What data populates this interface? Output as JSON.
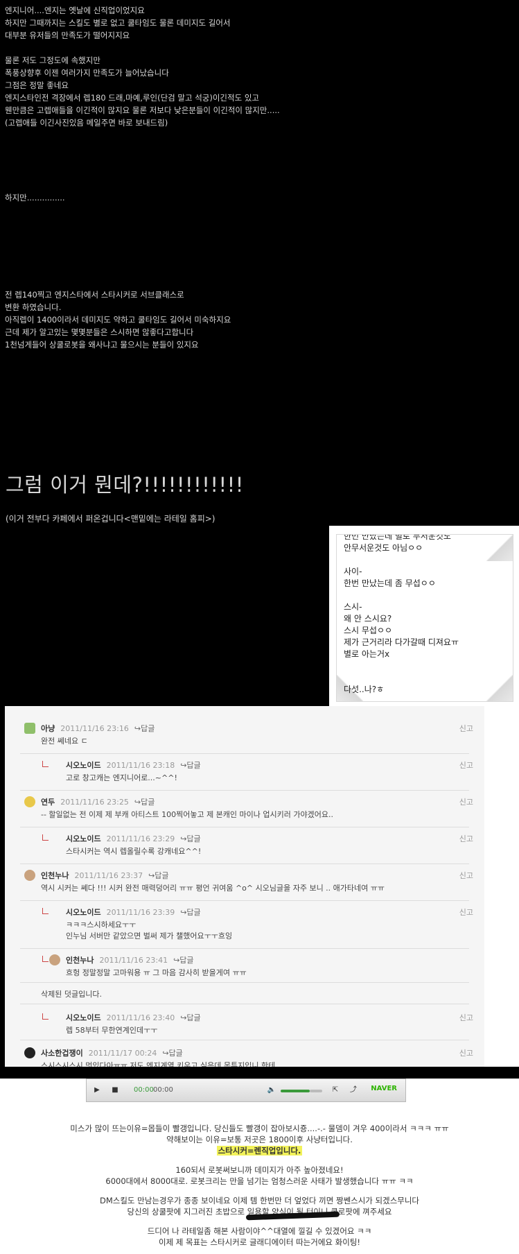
{
  "post": {
    "intro_lines": [
      "엔지니어....엔지는 옛날에 신직업이었지요",
      "하지만 그때까지는 스킬도 별로 없고 쿨타임도 물론 데미지도 길어서",
      "대부분 유저들의 만족도가 떨어지지요",
      "",
      "물론 저도 그정도에 속했지만",
      "폭풍상향후 이젠 여러가지 만족도가 늘어났습니다",
      "그점은 정말 좋네요",
      "엔지스타인전 격장에서 렙180 드래,마예,루인(단검 말고 석궁)이긴적도 있고",
      "웬만큼은 고렙애들을 이긴적이 많지요 물론 저보다 낮은분들이 이긴적이 많지만.....",
      "(고렙애들 이긴사진있음 메일주면 바로 보내드림)"
    ],
    "but_line": "하지만...............",
    "middle_lines": [
      "전 렙140찍고 엔지스타에서 스타시커로 서브클래스로",
      "변환 하였습니다.",
      "아직렙이 1400이라서 데미지도 약하고 쿨타임도 길어서 미숙하지요",
      "근데 제가 알고있는 몇몇분들은 스시하면 않좋다고합니다",
      "1천넘게들어 상쿨로봇을 왜사냐고 물으시는 분들이 있지요"
    ],
    "headline": "그럼 이거 뭔데?!!!!!!!!!!!!",
    "cafe_note": "(이거 전부다 카페에서 퍼온겁니다<맨밑에는 라테일 홈피>)"
  },
  "note": {
    "lines": [
      "한번 만났는데 별로 무서운것도",
      "안무서운것도 아님ㅇㅇ",
      "",
      "사이-",
      "한번 만났는데 좀 무섭ㅇㅇ",
      "",
      "스시-",
      "왜 안 스시요?",
      "스시 무섭ㅇㅇ",
      "제가 근거리라 다가갈때 디져요ㅠ",
      "별로 아는거x",
      "",
      "",
      "다섯..나?ㅎ"
    ]
  },
  "comments": [
    {
      "nick": "아냥",
      "date": "2011/11/16 23:16",
      "reply": "↪답글",
      "body": "완전 쎄네요 ㄷ",
      "report": "신고",
      "indent": false
    },
    {
      "nick": "시오노이드",
      "date": "2011/11/16 23:18",
      "reply": "↪답글",
      "body": "고로 창고캐는 엔지니어로...~^^!",
      "report": "신고",
      "indent": true
    },
    {
      "nick": "연두",
      "date": "2011/11/16 23:25",
      "reply": "↪답글",
      "body": "-- 할일없는 전 이제 제 부캐 아티스트 100찍어놓고 제 본캐인 마이나 업시키러 가야겠어요..",
      "report": "신고",
      "indent": false
    },
    {
      "nick": "시오노이드",
      "date": "2011/11/16 23:29",
      "reply": "↪답글",
      "body": "스타시커는 역시 렙올릴수록 강캐네요^^!",
      "report": "신고",
      "indent": true
    },
    {
      "nick": "인천누나",
      "date": "2011/11/16 23:37",
      "reply": "↪답글",
      "body": "역시 시커는 쎄다 !!! 시커 완전 매력덩어리 ㅠㅠ 평언 귀여움 ^o^ 시오님글을 자주 보니 .. 애가타네여 ㅠㅠ",
      "report": "신고",
      "indent": false
    },
    {
      "nick": "시오노이드",
      "date": "2011/11/16 23:39",
      "reply": "↪답글",
      "body": "ㅋㅋㅋ스시하세요ㅜㅜ",
      "body2": "인누님 서버만 같았으면 벌써 제가 챌했어요ㅜㅜ흐잉",
      "report": "신고",
      "indent": true
    },
    {
      "nick": "인천누나",
      "date": "2011/11/16 23:41",
      "reply": "↪답글",
      "body": "흐헝 정말정말 고마워용 ㅠ 그 마음 감사히 받을게여 ㅠㅠ",
      "report": "신고",
      "indent": true
    },
    {
      "deleted": "삭제된 덧글입니다."
    },
    {
      "nick": "시오노이드",
      "date": "2011/11/16 23:40",
      "reply": "↪답글",
      "body": "렙 58부터 무한연계인데ㅜㅜ",
      "report": "신고",
      "indent": true
    },
    {
      "nick": "사소한겁쟁이",
      "date": "2011/11/17 00:24",
      "reply": "↪답글",
      "body": "스시스시스시 멋있다아ㅠㅠ 저도 엔지계열 키우고 싶은데 몬투지입니 한테",
      "report": "신고",
      "indent": false
    }
  ],
  "player": {
    "time_elapsed": "00:00",
    "time_total": "00:00",
    "brand": "NAVER",
    "volume_fraction": 0.7
  },
  "bottom": {
    "lines": [
      "미스가 많이 뜨는이유=몹들이 빨갱입니다. 당신들도 빨갱이 잡아보시죵....-.- 물뎀이 겨우 400이라서 ㅋㅋㅋ ㅠㅠ",
      "약해보이는 이유=보통 저곳은 1800이후 사냥터입니다."
    ],
    "highlight": "스타시커=렌직업입니다.",
    "lines2": [
      "160되서 로봇써보니까 데미지가 아주 높아졌네요!",
      "6000대에서 8000대로. 로봇크리는 만을 넘기는 엄청스러운 사태가 발생했습니다 ㅠㅠ ㅋㅋ"
    ],
    "lines3": [
      "DM스킬도 만남는경우가 종종 보이네요 이제 템 한번만 더 엎었다 끼면 짱쎈스시가 되겠스무니다",
      "당신의 상쿨팟에 지그러진 초밥으로 일용할 양식이 될 터이니 쿨로팟에 껴주세요"
    ],
    "lines4": [
      "드디어 나 라테일좀 해본 사람이야^^대열에 낄길 수 있겠어요 ㅋㅋ",
      "이제 제 목표는 스타시커로 글래디에이터 따는거에요 화이팅!"
    ]
  },
  "colors": {
    "page_bg": "#000000",
    "comments_bg": "#f5f5f5",
    "highlight_bg": "#f2f25a",
    "naver_green": "#2db400",
    "reply_mark": "#cc4444"
  }
}
